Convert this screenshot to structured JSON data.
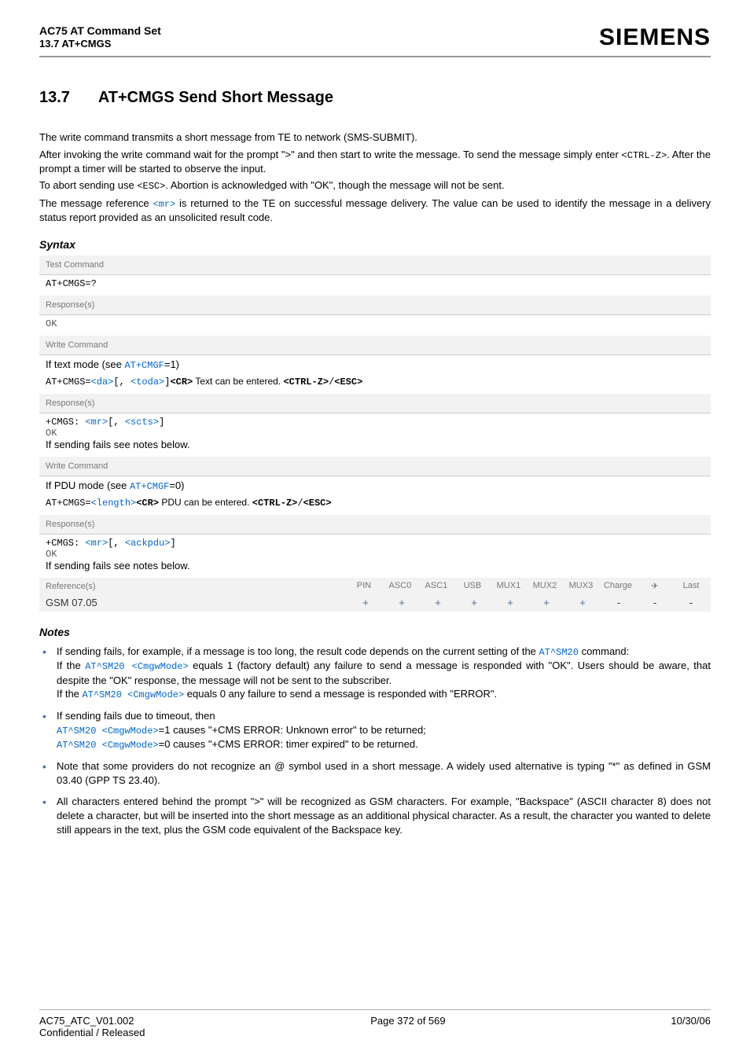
{
  "header": {
    "title": "AC75 AT Command Set",
    "subtitle": "13.7 AT+CMGS",
    "logo": "SIEMENS"
  },
  "section": {
    "number": "13.7",
    "title": "AT+CMGS   Send Short Message"
  },
  "intro": {
    "p1": "The write command transmits a short message from TE to network (SMS-SUBMIT).",
    "p2a": "After invoking the write command wait for the prompt \">\" and then start to write the message. To send the message simply enter ",
    "p2code": "<CTRL-Z>",
    "p2b": ". After the prompt a timer will be started to observe the input.",
    "p3a": "To abort sending use ",
    "p3code": "<ESC>",
    "p3b": ". Abortion is acknowledged with \"OK\", though the message will not be sent.",
    "p4a": "The message reference ",
    "p4code": "<mr>",
    "p4b": " is returned to the TE on successful message delivery. The value can be used to identify the message in a delivery status report provided as an unsolicited result code."
  },
  "syntax_label": "Syntax",
  "test": {
    "label": "Test Command",
    "cmd": "AT+CMGS=?",
    "resp_label": "Response(s)",
    "ok": "OK"
  },
  "write1": {
    "label": "Write Command",
    "mode_a": "If text mode (see ",
    "mode_link": "AT+CMGF",
    "mode_b": "=1)",
    "cmd_a": "AT+CMGS=",
    "da": "<da>",
    "toda": "<toda>",
    "cr": "<CR>",
    "txt": " Text can be entered. ",
    "ctrlz": "<CTRL-Z>",
    "esc": "<ESC>",
    "resp_label": "Response(s)",
    "resp_a": "+CMGS: ",
    "mr": "<mr>",
    "scts": "<scts>",
    "ok": "OK",
    "fail": "If sending fails see notes below."
  },
  "write2": {
    "label": "Write Command",
    "mode_a": "If PDU mode (see ",
    "mode_link": "AT+CMGF",
    "mode_b": "=0)",
    "cmd_a": "AT+CMGS=",
    "length": "<length>",
    "cr": "<CR>",
    "txt": " PDU can be entered. ",
    "ctrlz": "<CTRL-Z>",
    "esc": "<ESC>",
    "resp_label": "Response(s)",
    "resp_a": "+CMGS: ",
    "mr": "<mr>",
    "ackpdu": "<ackpdu>",
    "ok": "OK",
    "fail": "If sending fails see notes below."
  },
  "ref": {
    "label": "Reference(s)",
    "cols": [
      "PIN",
      "ASC0",
      "ASC1",
      "USB",
      "MUX1",
      "MUX2",
      "MUX3",
      "Charge",
      "✈",
      "Last"
    ],
    "name": "GSM 07.05",
    "vals": [
      "+",
      "+",
      "+",
      "+",
      "+",
      "+",
      "+",
      "-",
      "-",
      "-"
    ]
  },
  "notes_label": "Notes",
  "notes": {
    "n1a": "If sending fails, for example, if a message is too long, the result code depends on the current setting of the ",
    "n1link1": "AT^SM20",
    "n1b": " command:",
    "n1c": "If the ",
    "n1link2": "AT^SM20",
    "n1mode": " <CmgwMode>",
    "n1d": " equals 1 (factory default) any failure to send a message is responded with \"OK\". Users should be aware, that despite the \"OK\" response, the message will not be sent to the subscriber.",
    "n1e": "If the ",
    "n1f": " equals 0 any failure to send a message is responded with \"ERROR\".",
    "n2a": "If sending fails due to timeout, then",
    "n2b": "=1 causes \"+CMS ERROR: Unknown error\" to be returned;",
    "n2c": "=0 causes \"+CMS ERROR: timer expired\" to be returned.",
    "n3": "Note that some providers do not recognize an @ symbol used in a short message. A widely used alternative is typing \"*\" as defined in GSM 03.40 (GPP TS 23.40).",
    "n4": "All characters entered behind the prompt \">\" will be recognized as GSM characters. For example, \"Backspace\" (ASCII character 8) does not delete a character, but will be inserted into the short message as an additional physical character. As a result, the character you wanted to delete still appears in the text, plus the GSM code equivalent of the Backspace key."
  },
  "footer": {
    "doc": "AC75_ATC_V01.002",
    "conf": "Confidential / Released",
    "page": "Page 372 of 569",
    "date": "10/30/06"
  }
}
